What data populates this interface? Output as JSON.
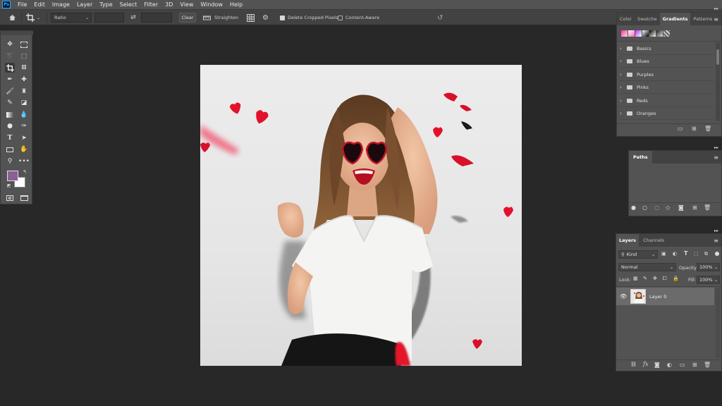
{
  "menu": [
    "File",
    "Edit",
    "Image",
    "Layer",
    "Type",
    "Select",
    "Filter",
    "3D",
    "View",
    "Window",
    "Help"
  ],
  "app_logo": "Ps",
  "options": {
    "ratio_label": "Ratio",
    "clear_label": "Clear",
    "straighten_label": "Straighten",
    "delete_cropped_label": "Delete Cropped Pixels",
    "delete_cropped_checked": true,
    "content_aware_label": "Content-Aware",
    "content_aware_checked": false
  },
  "colors": {
    "foreground": "#8c5f96",
    "background": "#ffffff",
    "accent_red": "#e3122c"
  },
  "gradients_panel": {
    "tabs": [
      "Color",
      "Swatche",
      "Gradients",
      "Patterns"
    ],
    "active_tab": "Gradients",
    "folders": [
      "Basics",
      "Blues",
      "Purples",
      "Pinks",
      "Reds",
      "Oranges"
    ]
  },
  "paths_panel": {
    "tabs": [
      "Paths"
    ]
  },
  "layers_panel": {
    "tabs": [
      "Layers",
      "Channels"
    ],
    "kind_label": "Kind",
    "blend_mode": "Normal",
    "opacity_label": "Opacity:",
    "opacity_value": "100%",
    "lock_label": "Lock:",
    "fill_label": "Fill:",
    "fill_value": "100%",
    "layers": [
      {
        "name": "Layer 0",
        "visible": true
      }
    ]
  }
}
